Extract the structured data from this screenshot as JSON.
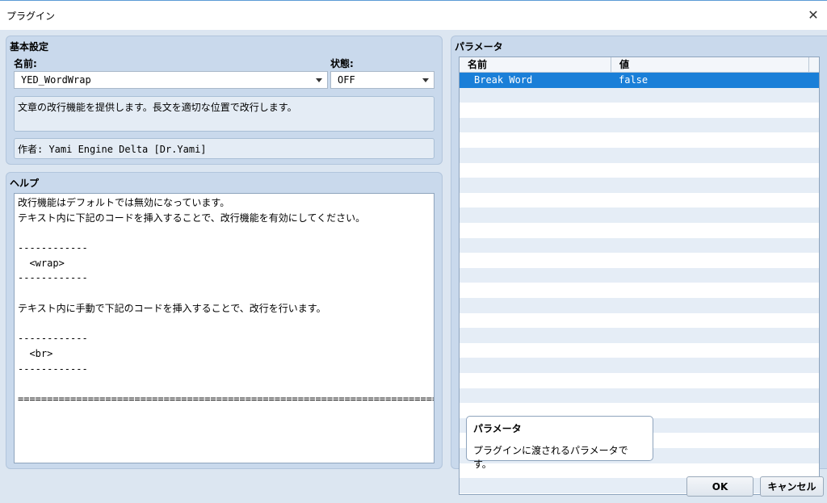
{
  "window": {
    "title": "プラグイン"
  },
  "basic": {
    "title": "基本設定",
    "name_label": "名前:",
    "name_value": "YED_WordWrap",
    "status_label": "状態:",
    "status_value": "OFF",
    "description": "文章の改行機能を提供します。長文を適切な位置で改行します。",
    "author": "作者: Yami Engine Delta [Dr.Yami]"
  },
  "help": {
    "title": "ヘルプ",
    "lines": [
      "改行機能はデフォルトでは無効になっています。",
      "テキスト内に下記のコードを挿入することで、改行機能を有効にしてください。",
      "",
      "------------",
      "  <wrap>",
      "------------",
      "",
      "テキスト内に手動で下記のコードを挿入することで、改行を行います。",
      "",
      "------------",
      "  <br>",
      "------------",
      "",
      "========================================================================="
    ]
  },
  "params": {
    "title": "パラメータ",
    "col_name": "名前",
    "col_value": "値",
    "rows": [
      {
        "name": "Break Word",
        "value": "false"
      }
    ],
    "tooltip_title": "パラメータ",
    "tooltip_body": "プラグインに渡されるパラメータです。"
  },
  "buttons": {
    "ok": "OK",
    "cancel": "キャンセル"
  },
  "colors": {
    "selected_row": "#1a7fd8",
    "panel": "#c9d9ec",
    "background": "#dce6f1"
  }
}
